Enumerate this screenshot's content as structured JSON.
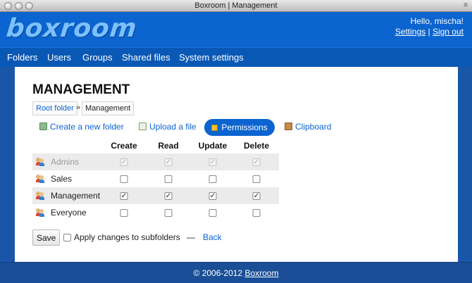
{
  "window": {
    "title": "Boxroom | Management"
  },
  "header": {
    "logo": "boxroom",
    "greeting": "Hello, mischa!",
    "settings_link": "Settings",
    "separator": "|",
    "signout_link": "Sign out"
  },
  "nav": {
    "items": [
      {
        "label": "Folders"
      },
      {
        "label": "Users"
      },
      {
        "label": "Groups"
      },
      {
        "label": "Shared files"
      },
      {
        "label": "System settings"
      }
    ]
  },
  "page": {
    "title": "MANAGEMENT",
    "breadcrumb": {
      "root": "Root folder",
      "separator": "»",
      "current": "Management"
    },
    "actions": {
      "create_folder": "Create a new folder",
      "upload_file": "Upload a file",
      "permissions": "Permissions",
      "clipboard": "Clipboard"
    }
  },
  "permissions": {
    "columns": [
      "Create",
      "Read",
      "Update",
      "Delete"
    ],
    "rows": [
      {
        "group": "Admins",
        "disabled": true,
        "create": true,
        "read": true,
        "update": true,
        "delete": true
      },
      {
        "group": "Sales",
        "disabled": false,
        "create": false,
        "read": false,
        "update": false,
        "delete": false
      },
      {
        "group": "Management",
        "disabled": false,
        "create": true,
        "read": true,
        "update": true,
        "delete": true
      },
      {
        "group": "Everyone",
        "disabled": false,
        "create": false,
        "read": false,
        "update": false,
        "delete": false
      }
    ]
  },
  "form": {
    "save_label": "Save",
    "apply_subfolders_label": "Apply changes to subfolders",
    "apply_subfolders_checked": false,
    "dash": "—",
    "back_label": "Back"
  },
  "footer": {
    "copyright": "© 2006-2012",
    "brand": "Boxroom"
  },
  "colors": {
    "header_blue": "#0b64cf",
    "nav_blue": "#0a58b5",
    "footer_blue": "#1a4e96",
    "link_blue": "#0b64cf",
    "stripe": "#ebebeb"
  }
}
